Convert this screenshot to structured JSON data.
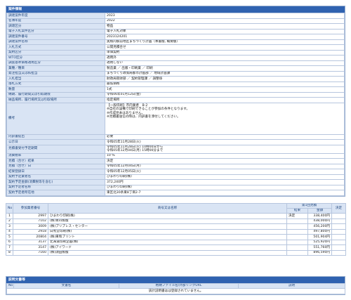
{
  "sections": {
    "case_info_title": "案件情報",
    "docs_title": "説明文書等"
  },
  "info_rows": [
    {
      "k": "調達案件年度",
      "v": "2023"
    },
    {
      "k": "名簿年度",
      "v": "2022"
    },
    {
      "k": "調達区分",
      "v": "物品"
    },
    {
      "k": "電子入札案件区分",
      "v": "電子入札対象"
    },
    {
      "k": "調達案件番号",
      "v": "2023124201"
    },
    {
      "k": "調達案件名称",
      "v": "奥駒内駅前地区まちづくり計画（本書版, 概要版）"
    },
    {
      "k": "入札方式",
      "v": "公開見積合せ"
    },
    {
      "k": "契約区分",
      "v": "単価契約"
    },
    {
      "k": "WTO区分",
      "v": "適用外"
    },
    {
      "k": "調査基準価格適用区分",
      "v": "適用しない"
    },
    {
      "k": "業種／種目",
      "v": "製造業 ／ 出版・印刷業 ／ 印刷"
    },
    {
      "k": "発注担当又は私担当",
      "v": "まちづくり政策局都市計画部 ／ 地域計画課"
    },
    {
      "k": "入札担当",
      "v": "財政局管財部 ／ 契約管理課 ／ 調整係"
    },
    {
      "k": "落札方式",
      "v": "最低価格"
    },
    {
      "k": "数量",
      "v": "1式"
    },
    {
      "k": "納期、履行期間又は引取期限",
      "v": "令和06年01月12日(金)"
    },
    {
      "k": "納品場所、履行場所又は引取場所",
      "v": "指定場所"
    }
  ],
  "remarks": {
    "k": "備考",
    "lines": [
      "【一般印刷】市内業者　B-2",
      "※自社の設備で印刷できることが参加の条件となります。",
      "※作成見本はありません。",
      "※見積書送信の際は、内訳書を添付してください。"
    ]
  },
  "info_rows2": [
    {
      "k": "内訳書提出",
      "v": "必要"
    },
    {
      "k": "公示日",
      "v": "令和05年11月28日(火)"
    }
  ],
  "period": {
    "k": "見積書受付予定期間",
    "lines": [
      "令和05年11月28日(火) 10時00分から",
      "令和05年12月04日(月) 15時00分まで"
    ]
  },
  "info_rows3": [
    {
      "k": "消費税率",
      "v": "10 %"
    },
    {
      "k": "見積（合せ）結果",
      "v": "決定"
    },
    {
      "k": "見積（合せ）日",
      "v": "令和05年12月04日(月)"
    },
    {
      "k": "結果登録日",
      "v": "令和05年12月05日(火)"
    },
    {
      "k": "契約予定業者名",
      "v": "ひまわり印刷(株)"
    },
    {
      "k": "契約予定金額(消費税等を含む)",
      "v": "372,240円"
    },
    {
      "k": "契約予定者名称",
      "v": "ひまわり印刷(株)"
    },
    {
      "k": "契約予定者所在地",
      "v": "東区北30条東8丁目2-7"
    }
  ],
  "bid_headers": {
    "no": "No",
    "reg": "参加業者番号",
    "name": "商号又は名称",
    "round": "第1回見積",
    "result": "結果",
    "amount": "金額",
    "decision": "決定"
  },
  "bidders": [
    {
      "no": "1",
      "reg": "2997",
      "name": "ひまわり印刷(株)",
      "result": "決定",
      "amount": "338,400円",
      "decision": ""
    },
    {
      "no": "2",
      "reg": "7102",
      "name": "(株)青丹製版",
      "result": "",
      "amount": "438,000円",
      "decision": ""
    },
    {
      "no": "3",
      "reg": "3009",
      "name": "(株)プリプレス・センター",
      "result": "",
      "amount": "456,200円",
      "decision": ""
    },
    {
      "no": "4",
      "reg": "2918",
      "name": "白馬堂印刷(株)",
      "result": "",
      "amount": "497,800円",
      "decision": ""
    },
    {
      "no": "5",
      "reg": "20804",
      "name": "(株)東和プリント",
      "result": "",
      "amount": "501,904円",
      "decision": ""
    },
    {
      "no": "6",
      "reg": "3137",
      "name": "北海道印刷企画(株)",
      "result": "",
      "amount": "525,920円",
      "decision": ""
    },
    {
      "no": "7",
      "reg": "3147",
      "name": "(株)アイワード",
      "result": "",
      "amount": "551,760円",
      "decision": ""
    },
    {
      "no": "8",
      "reg": "7160",
      "name": "(株)須田製版",
      "result": "",
      "amount": "896,590円",
      "decision": ""
    }
  ],
  "doc_headers": {
    "no": "No",
    "doc": "文書名",
    "file": "格納ファイル名/外部リンクURL",
    "desc": "説明"
  },
  "docs_empty": "該計説明書はは登録されていません。"
}
